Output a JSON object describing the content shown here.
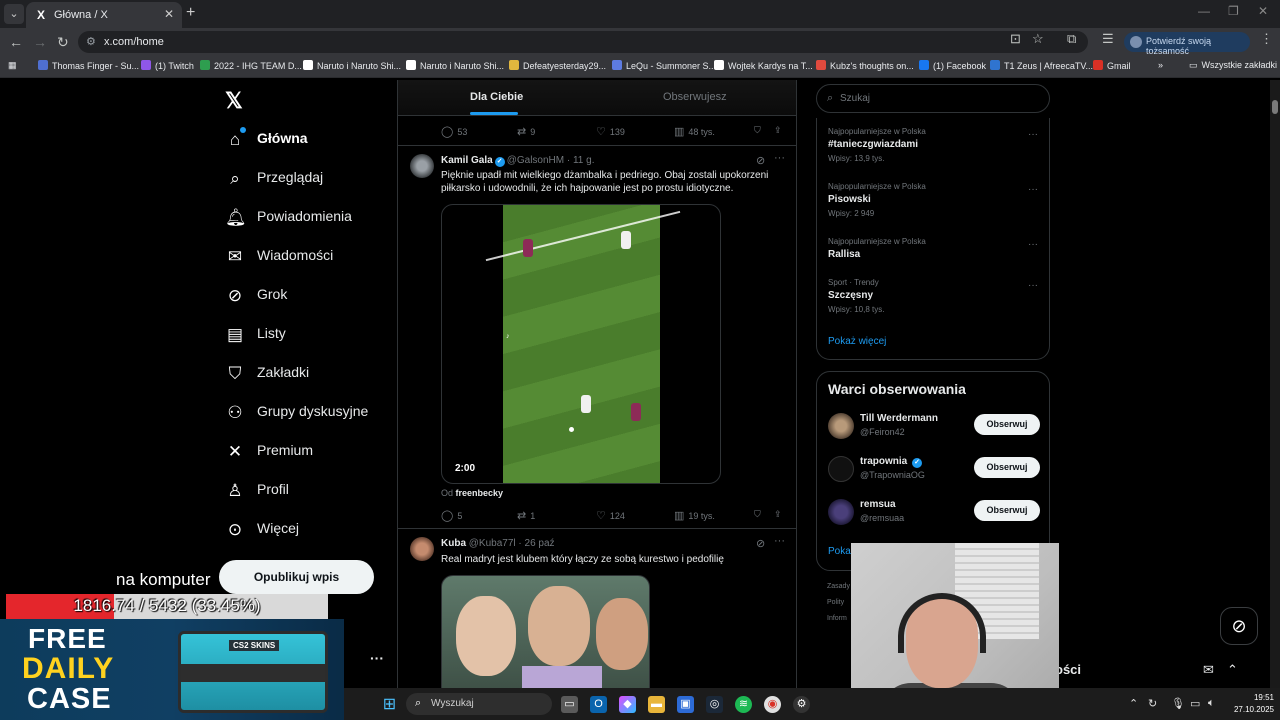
{
  "browser": {
    "tab_title": "Główna / X",
    "tab_favicon": "X",
    "url": "x.com/home",
    "verify_label": "Potwierdź swoją tożsamość",
    "bookmarks": [
      {
        "label": "Thomas Finger - Su...",
        "color": "#4f6fd1"
      },
      {
        "label": "(1) Twitch",
        "color": "#8f57e8"
      },
      {
        "label": "2022 - IHG TEAM D...",
        "color": "#2e9e4f"
      },
      {
        "label": "Naruto i Naruto Shi...",
        "color": "#ffffff"
      },
      {
        "label": "Naruto i Naruto Shi...",
        "color": "#ffffff"
      },
      {
        "label": "Defeatyesterday29...",
        "color": "#e0b63e"
      },
      {
        "label": "LeQu - Summoner S...",
        "color": "#5d7be0"
      },
      {
        "label": "Wojtek Kardys na T...",
        "color": "#ffffff"
      },
      {
        "label": "Kubz's thoughts on...",
        "color": "#e04a3e"
      },
      {
        "label": "(1) Facebook",
        "color": "#1877f2"
      },
      {
        "label": "T1 Zeus | AfreecaTV...",
        "color": "#2f74d0"
      },
      {
        "label": "Gmail",
        "color": "#d93025"
      }
    ],
    "all_bookmarks": "Wszystkie zakładki"
  },
  "nav": {
    "items": [
      {
        "label": "Główna",
        "icon": "home-icon"
      },
      {
        "label": "Przeglądaj",
        "icon": "search-icon"
      },
      {
        "label": "Powiadomienia",
        "icon": "bell-icon"
      },
      {
        "label": "Wiadomości",
        "icon": "mail-icon"
      },
      {
        "label": "Grok",
        "icon": "grok-icon"
      },
      {
        "label": "Listy",
        "icon": "list-icon"
      },
      {
        "label": "Zakładki",
        "icon": "bookmark-icon"
      },
      {
        "label": "Grupy dyskusyjne",
        "icon": "communities-icon"
      },
      {
        "label": "Premium",
        "icon": "x-icon"
      },
      {
        "label": "Profil",
        "icon": "user-icon"
      },
      {
        "label": "Więcej",
        "icon": "more-circle-icon"
      }
    ],
    "publish": "Opublikuj wpis"
  },
  "timeline": {
    "tab_for_you": "Dla Ciebie",
    "tab_following": "Obserwujesz",
    "prev_post_stats": {
      "replies": "53",
      "reposts": "9",
      "likes": "139",
      "views": "48 tys."
    },
    "posts": [
      {
        "name": "Kamil Gala",
        "handle": "@GalsonHM · 11 g.",
        "text": "Pięknie upadł mit wielkiego dżambalka i pedriego. Obaj zostali upokorzeni piłkarsko i udowodnili, że ich hajpowanie jest po prostu idiotyczne.",
        "video_duration": "2:00",
        "from_label": "Od",
        "from_user": "freenbecky",
        "stats": {
          "replies": "5",
          "reposts": "1",
          "likes": "124",
          "views": "19 tys."
        }
      },
      {
        "name": "Kuba",
        "handle": "@Kuba77l · 26 paź",
        "text": "Real madryt jest klubem który łączy ze sobą kurestwo i pedofilię"
      }
    ]
  },
  "sidebar": {
    "search_placeholder": "Szukaj",
    "trends": [
      {
        "context": "Najpopularniejsze w Polska",
        "name": "#tanieczgwiazdami",
        "count": "Wpisy: 13,9 tys."
      },
      {
        "context": "Najpopularniejsze w Polska",
        "name": "Pisowski",
        "count": "Wpisy: 2 949"
      },
      {
        "context": "Najpopularniejsze w Polska",
        "name": "Rallisa",
        "count": ""
      },
      {
        "context": "Sport · Trendy",
        "name": "Szczęsny",
        "count": "Wpisy: 10,8 tys."
      }
    ],
    "show_more": "Pokaż więcej",
    "who_to_follow_title": "Warci obserwowania",
    "suggestions": [
      {
        "name": "Till Werdermann",
        "handle": "@Feiron42",
        "verified": false
      },
      {
        "name": "trapownia",
        "handle": "@TrapowniaOG",
        "verified": true
      },
      {
        "name": "remsua",
        "handle": "@remsuaa",
        "verified": false
      }
    ],
    "follow_label": "Obserwuj",
    "wtf_more": "Pokaż",
    "footer": [
      "Zasady",
      "Polity",
      "Inform"
    ],
    "messages_title": "ości"
  },
  "overlay": {
    "text": "na komputer",
    "progress_text": "1816.74 / 5432 (33.45%)",
    "progress_fraction": 0.3345,
    "promo_l1": "FREE",
    "promo_l2": "DAILY",
    "promo_l3": "CASE",
    "promo_brand": "CS2 SKINS"
  },
  "taskbar": {
    "search": "Wyszukaj",
    "time": "19:51",
    "date": "27.10.2025"
  }
}
